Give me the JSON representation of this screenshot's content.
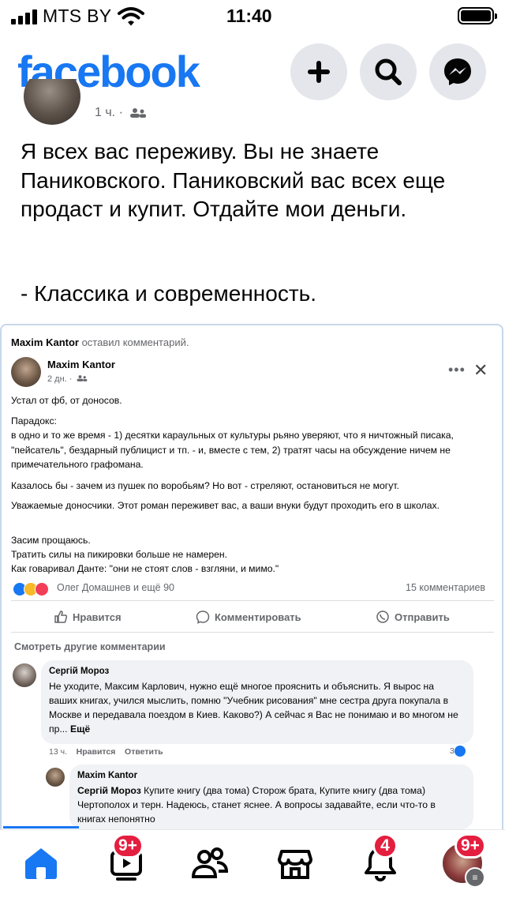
{
  "status_bar": {
    "carrier": "MTS BY",
    "time": "11:40"
  },
  "header": {
    "logo": "facebook",
    "icons": [
      "plus-icon",
      "search-icon",
      "messenger-icon"
    ],
    "brand_color": "#1877f2"
  },
  "post": {
    "author_meta_partial": "1 ч. ·",
    "text": "Я всех вас переживу. Вы не знаете Паниковского. Паниковский вас всех еще продаст и купит. Отдайте мои деньги.",
    "signoff": "- Классика и современность."
  },
  "embedded": {
    "caption_author": "Maxim Kantor",
    "caption_rest": " оставил комментарий.",
    "author": "Maxim Kantor",
    "time": "2 дн. ·",
    "paragraphs": [
      "Устал от фб, от доносов.",
      "Парадокс:",
      "в одно и то же время - 1) десятки караульных от культуры рьяно уверяют, что я ничтожный писака, \"пейсатель\", бездарный публицист и тп. - и, вместе с тем, 2) тратят часы на обсуждение ничем не примечательного графомана.",
      "Казалось бы - зачем из пушек по воробьям? Но вот - стреляют, остановиться не могут.",
      "Уважаемые доносчики. Этот роман переживет вас, а ваши внуки будут проходить его в школах.",
      "Засим прощаюсь.",
      "Тратить силы на пикировки больше не намерен.",
      "Как говаривал Данте: \"они не стоят слов - взгляни, и мимо.\""
    ],
    "reactions_text": "Олег Домашнев и ещё 90",
    "comments_count": "15 комментариев",
    "actions": {
      "like": "Нравится",
      "comment": "Комментировать",
      "share": "Отправить"
    },
    "see_more_comments": "Смотреть другие комментарии",
    "comments": [
      {
        "author": "Сергій Мороз",
        "text": "Не уходите, Максим Карлович, нужно ещё многое прояснить и объяснить. Я вырос на ваших книгах, учился мыслить, помню \"Учебник рисования\" мне сестра друга покупала в Москве и передавала поездом в Киев. Каково?) А сейчас я Вас не понимаю и во многом не пр...",
        "more": "Ещё",
        "time": "13 ч.",
        "like": "Нравится",
        "reply": "Ответить",
        "reactions": "3"
      },
      {
        "author": "Maxim Kantor",
        "mention": "Сергій Мороз",
        "text": " Купите книгу (два тома) Сторож брата, Купите книгу (два тома) Чертополох и терн. Надеюсь, станет яснее. А вопросы задавайте, если что-то в книгах непонятно"
      }
    ]
  },
  "bottom_nav": {
    "items": [
      {
        "icon": "home-icon",
        "badge": ""
      },
      {
        "icon": "video-icon",
        "badge": "9+"
      },
      {
        "icon": "friends-icon",
        "badge": ""
      },
      {
        "icon": "marketplace-icon",
        "badge": ""
      },
      {
        "icon": "bell-icon",
        "badge": "4"
      },
      {
        "icon": "profile-menu-icon",
        "badge": "9+"
      }
    ]
  }
}
